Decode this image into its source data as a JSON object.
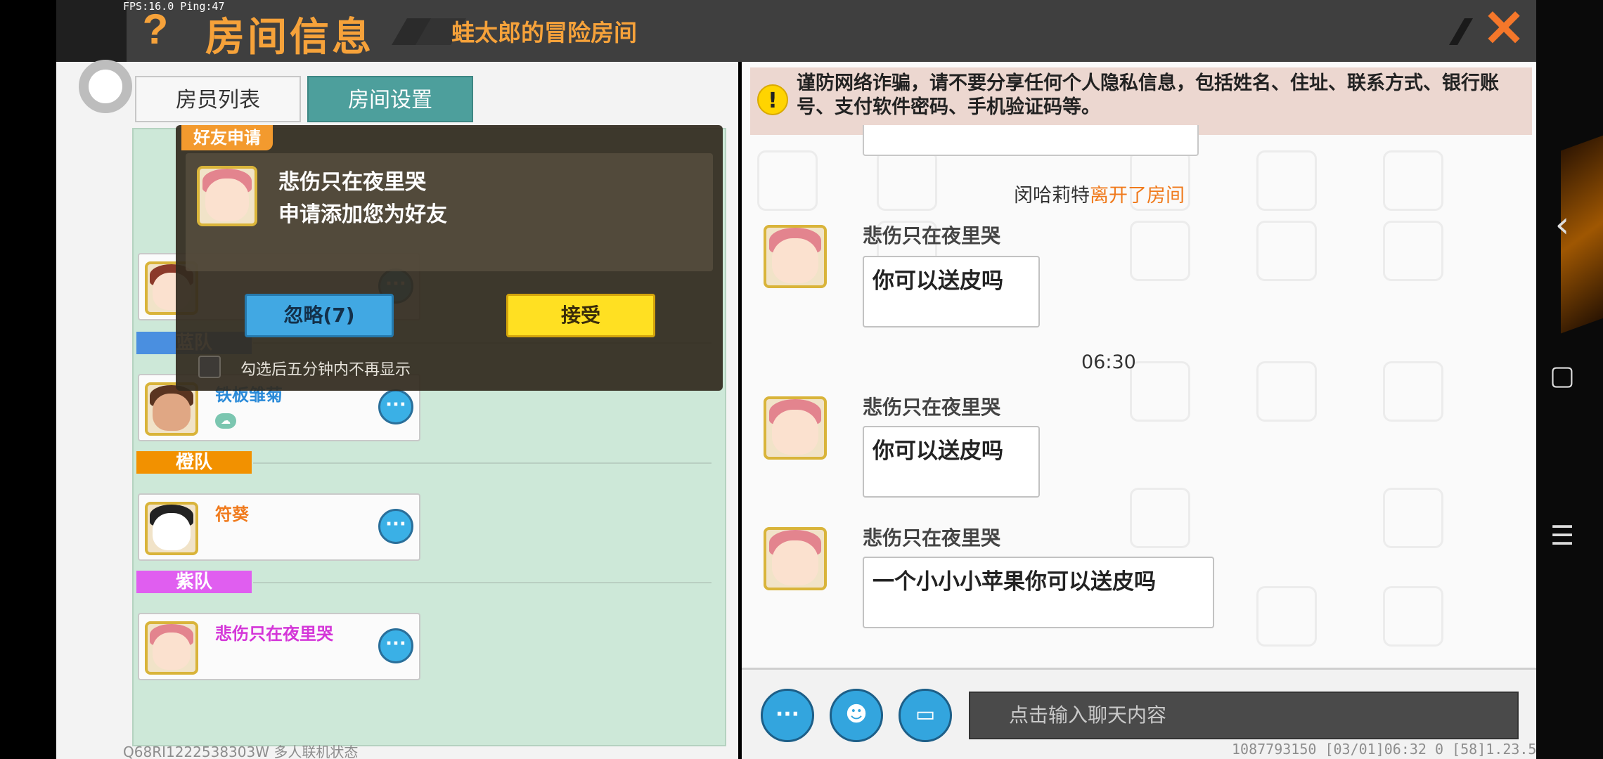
{
  "status": {
    "fps": "FPS:16.0  Ping:47"
  },
  "header": {
    "help": "?",
    "title": "房间信息",
    "subtitle": "蛙太郎的冒险房间",
    "close": "✕"
  },
  "tabs": {
    "members": "房员列表",
    "settings": "房间设置"
  },
  "teams": [
    {
      "label": "蓝队",
      "color": "#4a8fe0"
    },
    {
      "label": "橙队",
      "color": "#f29100"
    },
    {
      "label": "紫队",
      "color": "#e05ef0"
    }
  ],
  "members": [
    {
      "name": "",
      "color": "#2a8ad8"
    },
    {
      "name": "铁板雏菊",
      "color": "#2a8ad8"
    },
    {
      "name": "符葵",
      "color": "#f07a1c"
    },
    {
      "name": "悲伤只在夜里哭",
      "color": "#d436d8"
    }
  ],
  "popup": {
    "tag": "好友申请",
    "name": "悲伤只在夜里哭",
    "message": "申请添加您为好友",
    "ignore": "忽略(7)",
    "accept": "接受",
    "checkbox_label": "勾选后五分钟内不再显示"
  },
  "warning": {
    "icon": "!",
    "text": "谨防网络诈骗，请不要分享任何个人隐私信息，包括姓名、住址、联系方式、银行账号、支付软件密码、手机验证码等。"
  },
  "chat": {
    "system": {
      "user": "闵哈莉特",
      "action": "离开了房间"
    },
    "time": "06:30",
    "messages": [
      {
        "sender": "悲伤只在夜里哭",
        "text": "你可以送皮吗"
      },
      {
        "sender": "悲伤只在夜里哭",
        "text": "你可以送皮吗"
      },
      {
        "sender": "悲伤只在夜里哭",
        "text": "一个小小小苹果你可以送皮吗"
      }
    ]
  },
  "input": {
    "placeholder": "点击输入聊天内容"
  },
  "footer": {
    "left": "Q68RI1222538303W 多人联机状态",
    "right": "1087793150   [03/01]06:32 0   [58]1.23.5"
  },
  "colors": {
    "accent": "#f6a23a",
    "teal_tab": "#4d9f9c",
    "chat_button": "#33a5de"
  },
  "nav": {
    "back": "‹",
    "home": "▢",
    "menu": "☰"
  }
}
